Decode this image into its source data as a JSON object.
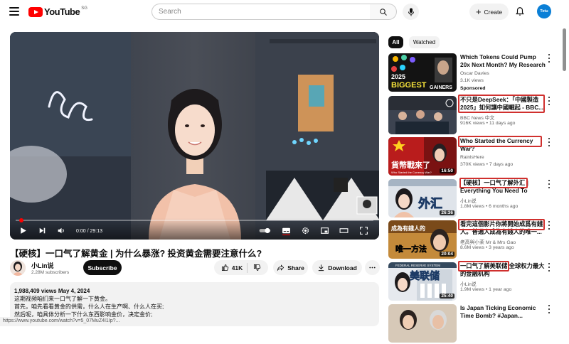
{
  "header": {
    "logo_text": "YouTube",
    "region": "SG",
    "search_placeholder": "Search",
    "create_label": "Create",
    "avatar_text": "Tetu"
  },
  "player": {
    "time": "0:00 / 29:13",
    "progress": 0.0
  },
  "video": {
    "title": "【硬核】一口气了解黄金 | 为什么暴涨? 投资黄金需要注意什么?",
    "channel": "小Lin说",
    "subscribers": "2.28M subscribers",
    "subscribe_label": "Subscribe",
    "likes": "41K",
    "share_label": "Share",
    "download_label": "Download"
  },
  "description": {
    "meta": "1,988,409 views  May 4, 2024",
    "lines": [
      "这期视频咱们来一口气了解一下黄金。",
      "首先，咱先看看黄金的供需，什么人在生产啊、什么人在买;",
      "然后呢，咱具体分析一下什么东西影响金价，决定金价;"
    ]
  },
  "url_bar": "https://www.youtube.com/watch?v=5_07MuZ4I1Ip?...",
  "chips": [
    "All",
    "Watched"
  ],
  "recommendations": [
    {
      "title": "Which Tokens Could Pump 20x Next Month? My Research",
      "channel": "Oscar Davies",
      "meta": "3.1K views",
      "extra": "Sponsored",
      "duration": ""
    },
    {
      "title": "不只是DeepSeek：「中國製造2025」如何讓中國崛起 - BBC...",
      "channel": "BBC News 中文",
      "meta": "916K views • 11 days ago",
      "extra": "",
      "duration": ""
    },
    {
      "title": "Who Started the Currency War?",
      "channel": "RainlsHere",
      "meta": "370K views • 7 days ago",
      "extra": "",
      "duration": "16:50"
    },
    {
      "title": "【硬核】一口气了解外汇 | Everything You Need To Know...",
      "channel": "小Lin说",
      "meta": "1.8M views • 6 months ago",
      "extra": "",
      "duration": "26:36"
    },
    {
      "title": "看完這個影片你將開始成爲有錢人。普通人成為有錢人的唯一...",
      "channel": "老高與小茉 Mr & Mrs Gao",
      "meta": "8.6M views • 3 years ago",
      "extra": "",
      "duration": "20:04"
    },
    {
      "title": "一口气了解美联储 全球权力最大的金融机构",
      "channel": "小Lin说",
      "meta": "1.9M views • 1 year ago",
      "extra": "",
      "duration": "25:40"
    },
    {
      "title": "Is Japan Ticking Economic Time Bomb? #Japan...",
      "channel": "",
      "meta": "",
      "extra": "",
      "duration": ""
    }
  ],
  "thumb_texts": {
    "t1a": "2025",
    "t1b": "BIGGEST",
    "t1c": "GAINERS",
    "t3": "貨幣戰來了",
    "t3sub": "Who Started the Currency War?",
    "t4": "外汇",
    "t5": "成為有錢人的",
    "t5b": "唯一方法",
    "t6": "美联储",
    "t6top": "FEDERAL RESERVE SYSTEM"
  },
  "colors": {
    "brand_red": "#ff0000",
    "annotation_red": "#d0302e"
  }
}
